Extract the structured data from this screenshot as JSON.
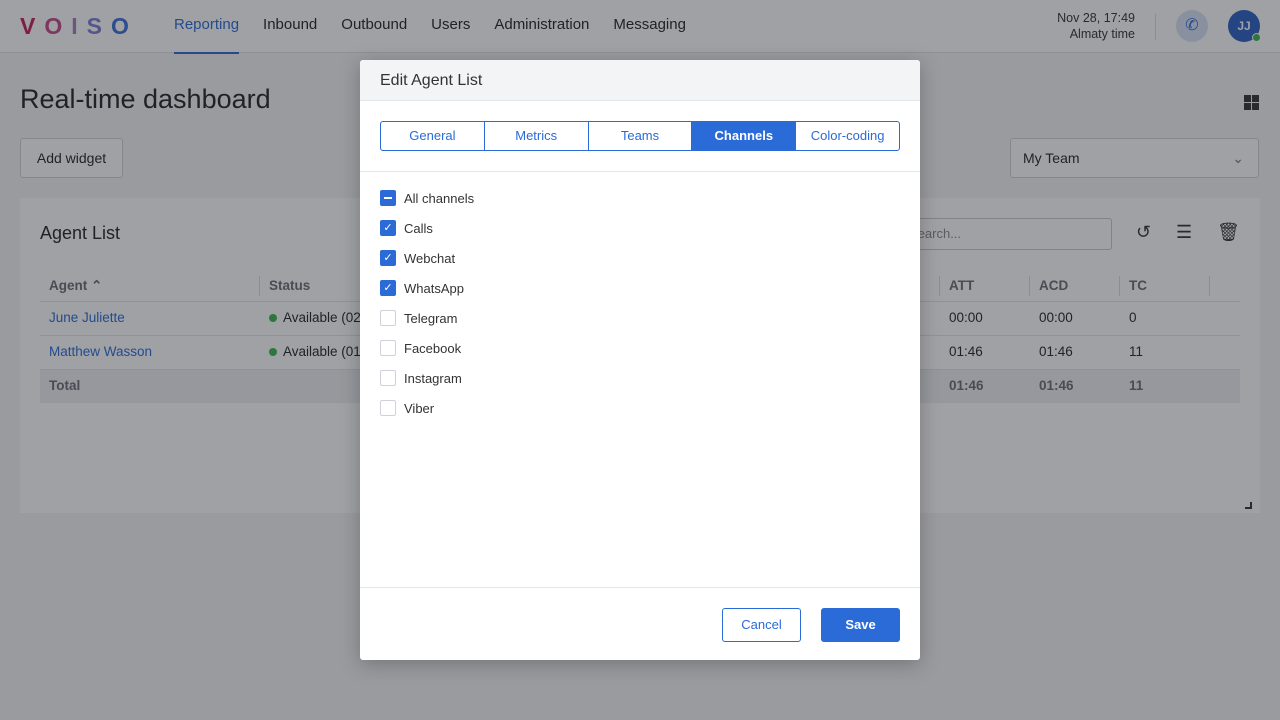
{
  "header": {
    "logo": "VOISO",
    "nav": [
      "Reporting",
      "Inbound",
      "Outbound",
      "Users",
      "Administration",
      "Messaging"
    ],
    "active_nav": "Reporting",
    "datetime": "Nov 28, 17:49",
    "timezone": "Almaty time",
    "avatar_initials": "JJ",
    "accent": "#2a6bd8"
  },
  "page": {
    "title": "Real-time dashboard",
    "add_widget": "Add widget",
    "team_select": "My Team"
  },
  "widget": {
    "title": "Agent List",
    "search_placeholder": "Search...",
    "columns": [
      "Agent",
      "Status",
      "ATT",
      "ACD",
      "TC"
    ],
    "rows": [
      {
        "agent": "June Juliette",
        "status": "Available (02",
        "att": "00:00",
        "acd": "00:00",
        "tc": "0"
      },
      {
        "agent": "Matthew Wasson",
        "status": "Available (01",
        "att": "01:46",
        "acd": "01:46",
        "tc": "11"
      }
    ],
    "total": {
      "label": "Total",
      "att": "01:46",
      "acd": "01:46",
      "tc": "11"
    }
  },
  "modal": {
    "title": "Edit Agent List",
    "tabs": [
      "General",
      "Metrics",
      "Teams",
      "Channels",
      "Color-coding"
    ],
    "active_tab": "Channels",
    "all_channels": {
      "label": "All channels",
      "state": "indeterminate"
    },
    "channels": [
      {
        "label": "Calls",
        "checked": true
      },
      {
        "label": "Webchat",
        "checked": true
      },
      {
        "label": "WhatsApp",
        "checked": true
      },
      {
        "label": "Telegram",
        "checked": false
      },
      {
        "label": "Facebook",
        "checked": false
      },
      {
        "label": "Instagram",
        "checked": false
      },
      {
        "label": "Viber",
        "checked": false
      }
    ],
    "cancel": "Cancel",
    "save": "Save"
  }
}
